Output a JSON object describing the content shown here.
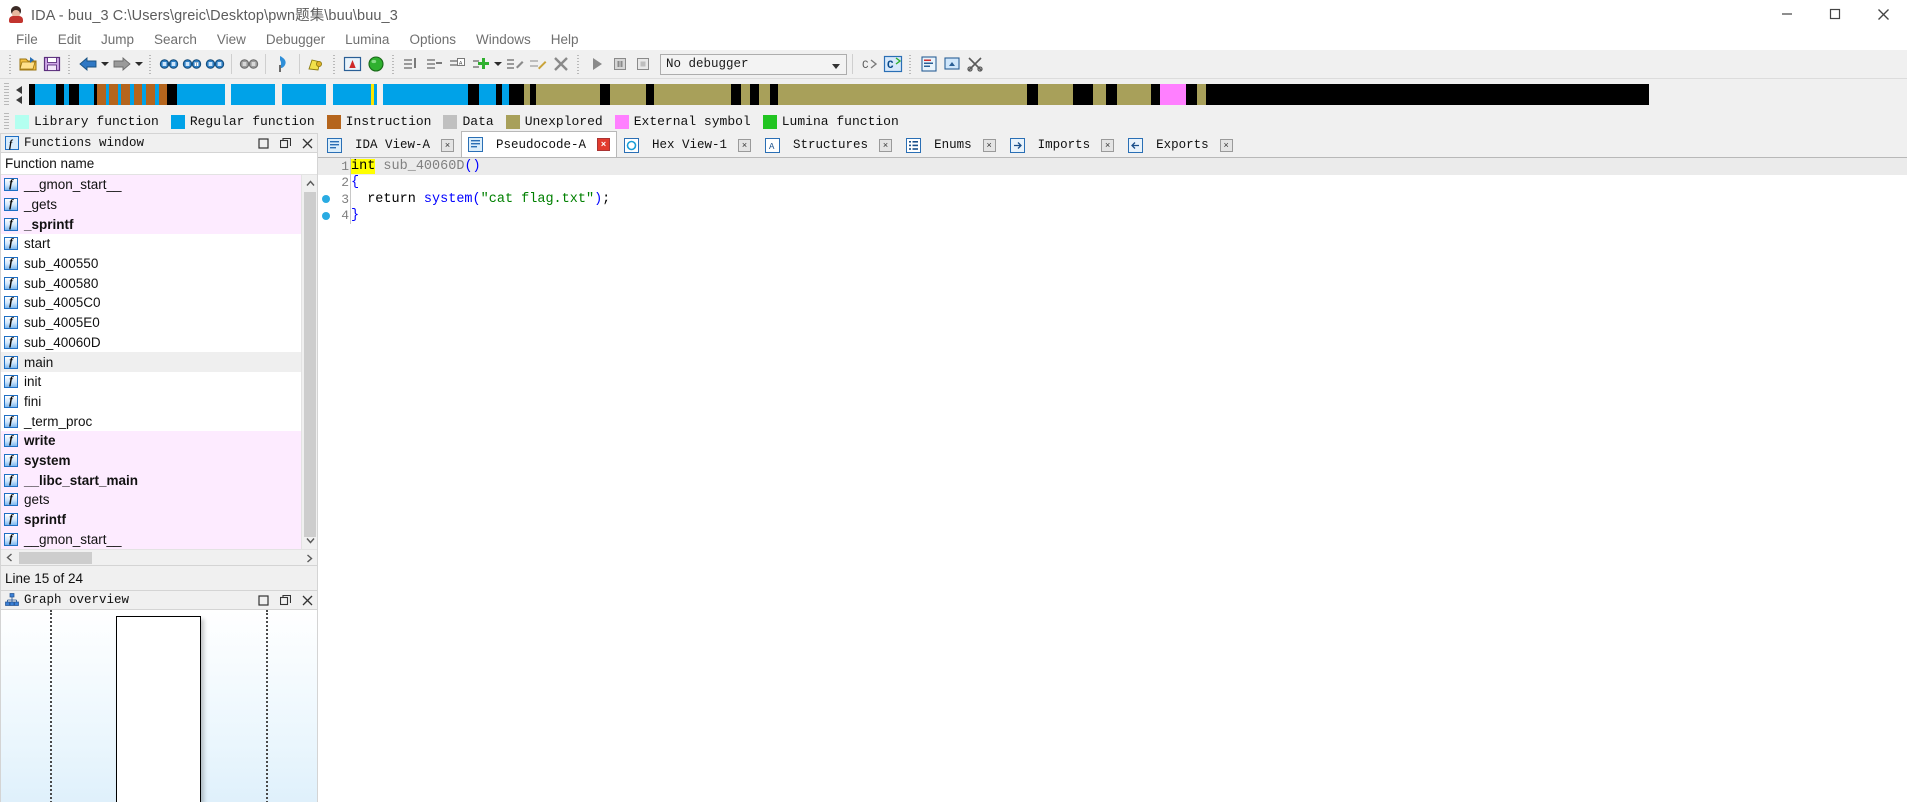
{
  "window": {
    "title": "IDA - buu_3 C:\\Users\\greic\\Desktop\\pwn题集\\buu\\buu_3",
    "icon": "ida-app-icon",
    "buttons": {
      "minimize": "minimize-icon",
      "maximize": "maximize-icon",
      "close": "close-icon"
    }
  },
  "menu": {
    "items": [
      {
        "label": "File"
      },
      {
        "label": "Edit"
      },
      {
        "label": "Jump"
      },
      {
        "label": "Search"
      },
      {
        "label": "View"
      },
      {
        "label": "Debugger"
      },
      {
        "label": "Lumina"
      },
      {
        "label": "Options"
      },
      {
        "label": "Windows"
      },
      {
        "label": "Help"
      }
    ]
  },
  "toolbar": {
    "debugger_select": {
      "value": "No debugger",
      "placeholder": "No debugger"
    },
    "buttons": [
      {
        "name": "open-file-icon"
      },
      {
        "name": "save-file-icon"
      },
      {
        "name": "back-icon"
      },
      {
        "name": "forward-icon"
      },
      {
        "name": "search-binary-icon"
      },
      {
        "name": "search-text-icon"
      },
      {
        "name": "search-next-icon"
      },
      {
        "name": "search-prev-icon"
      },
      {
        "name": "blue-flag-icon"
      },
      {
        "name": "highlight-icon"
      },
      {
        "name": "ida-view-icon"
      },
      {
        "name": "run-to-cursor-icon"
      },
      {
        "name": "add-breakpoint-icon"
      },
      {
        "name": "del-breakpoint-icon"
      },
      {
        "name": "add-code-icon"
      },
      {
        "name": "add-plus-icon"
      },
      {
        "name": "edit-func-icon"
      },
      {
        "name": "undefine-icon"
      },
      {
        "name": "delete-x-icon"
      },
      {
        "name": "run-icon"
      },
      {
        "name": "pause-icon"
      },
      {
        "name": "stop-icon"
      },
      {
        "name": "c-decompile-icon"
      },
      {
        "name": "c-plugin-icon"
      },
      {
        "name": "strings-icon"
      },
      {
        "name": "lumina-push-icon"
      },
      {
        "name": "lumina-cut-icon"
      }
    ]
  },
  "navigator": {
    "marker_position_pct": 18.5,
    "segments": [
      {
        "color": "#bfbfbf",
        "width_pct": 0.0
      },
      {
        "color": "#000000",
        "width_pct": 0.35
      },
      {
        "color": "#00a2e8",
        "width_pct": 1.1
      },
      {
        "color": "#000000",
        "width_pct": 0.45
      },
      {
        "color": "#00a2e8",
        "width_pct": 0.25
      },
      {
        "color": "#000000",
        "width_pct": 0.55
      },
      {
        "color": "#00a2e8",
        "width_pct": 0.8
      },
      {
        "color": "#000000",
        "width_pct": 0.2
      },
      {
        "color": "#b5651d",
        "width_pct": 0.45
      },
      {
        "color": "#00a2e8",
        "width_pct": 0.2
      },
      {
        "color": "#b5651d",
        "width_pct": 0.45
      },
      {
        "color": "#00a2e8",
        "width_pct": 0.2
      },
      {
        "color": "#b5651d",
        "width_pct": 0.5
      },
      {
        "color": "#00a2e8",
        "width_pct": 0.2
      },
      {
        "color": "#b5651d",
        "width_pct": 0.45
      },
      {
        "color": "#00a2e8",
        "width_pct": 0.2
      },
      {
        "color": "#b5651d",
        "width_pct": 0.5
      },
      {
        "color": "#00a2e8",
        "width_pct": 0.2
      },
      {
        "color": "#b5651d",
        "width_pct": 0.45
      },
      {
        "color": "#000000",
        "width_pct": 0.5
      },
      {
        "color": "#00a2e8",
        "width_pct": 2.6
      },
      {
        "color": "#f0f0f0",
        "width_pct": 0.35
      },
      {
        "color": "#00a2e8",
        "width_pct": 2.4
      },
      {
        "color": "#f0f0f0",
        "width_pct": 0.35
      },
      {
        "color": "#00a2e8",
        "width_pct": 2.4
      },
      {
        "color": "#f0f0f0",
        "width_pct": 0.35
      },
      {
        "color": "#00a2e8",
        "width_pct": 2.4
      },
      {
        "color": "#f0f0f0",
        "width_pct": 0.35
      },
      {
        "color": "#00a2e8",
        "width_pct": 4.6
      },
      {
        "color": "#000000",
        "width_pct": 0.6
      },
      {
        "color": "#00a2e8",
        "width_pct": 0.9
      },
      {
        "color": "#000000",
        "width_pct": 0.35
      },
      {
        "color": "#00a2e8",
        "width_pct": 0.35
      },
      {
        "color": "#000000",
        "width_pct": 0.8
      },
      {
        "color": "#a8a05a",
        "width_pct": 0.35
      },
      {
        "color": "#000000",
        "width_pct": 0.3
      },
      {
        "color": "#a8a05a",
        "width_pct": 3.5
      },
      {
        "color": "#000000",
        "width_pct": 0.5
      },
      {
        "color": "#a8a05a",
        "width_pct": 2.0
      },
      {
        "color": "#000000",
        "width_pct": 0.4
      },
      {
        "color": "#a8a05a",
        "width_pct": 4.2
      },
      {
        "color": "#000000",
        "width_pct": 0.5
      },
      {
        "color": "#a8a05a",
        "width_pct": 0.5
      },
      {
        "color": "#000000",
        "width_pct": 0.5
      },
      {
        "color": "#a8a05a",
        "width_pct": 0.6
      },
      {
        "color": "#000000",
        "width_pct": 0.4
      },
      {
        "color": "#a8a05a",
        "width_pct": 13.5
      },
      {
        "color": "#000000",
        "width_pct": 0.6
      },
      {
        "color": "#a8a05a",
        "width_pct": 1.9
      },
      {
        "color": "#000000",
        "width_pct": 1.1
      },
      {
        "color": "#a8a05a",
        "width_pct": 0.7
      },
      {
        "color": "#000000",
        "width_pct": 0.6
      },
      {
        "color": "#a8a05a",
        "width_pct": 1.8
      },
      {
        "color": "#000000",
        "width_pct": 0.5
      },
      {
        "color": "#ff7fff",
        "width_pct": 1.4
      },
      {
        "color": "#000000",
        "width_pct": 0.6
      },
      {
        "color": "#a8a05a",
        "width_pct": 0.5
      },
      {
        "color": "#000000",
        "width_pct": 24.0
      },
      {
        "color": "#f0f0f0",
        "width_pct": 18.0
      }
    ]
  },
  "legend": {
    "items": [
      {
        "label": "Library function",
        "color": "#b3fff0"
      },
      {
        "label": "Regular function",
        "color": "#00a2e8"
      },
      {
        "label": "Instruction",
        "color": "#b5651d"
      },
      {
        "label": "Data",
        "color": "#c0c0c0"
      },
      {
        "label": "Unexplored",
        "color": "#a8a05a"
      },
      {
        "label": "External symbol",
        "color": "#ff7fff"
      },
      {
        "label": "Lumina function",
        "color": "#22c522"
      }
    ]
  },
  "functions_window": {
    "panel_title": "Functions window",
    "panel_icon": "function-panel-icon",
    "column_header": "Function name",
    "status": "Line 15 of 24",
    "panel_buttons": [
      {
        "name": "maximize-panel-icon"
      },
      {
        "name": "float-panel-icon"
      },
      {
        "name": "close-panel-icon"
      }
    ],
    "rows": [
      {
        "name": "__gmon_start__",
        "kind": "library",
        "bold": false,
        "selected": false
      },
      {
        "name": "_gets",
        "kind": "library",
        "bold": false,
        "selected": false
      },
      {
        "name": "_sprintf",
        "kind": "library",
        "bold": true,
        "selected": false
      },
      {
        "name": "start",
        "kind": "regular",
        "bold": false,
        "selected": false
      },
      {
        "name": "sub_400550",
        "kind": "regular",
        "bold": false,
        "selected": false
      },
      {
        "name": "sub_400580",
        "kind": "regular",
        "bold": false,
        "selected": false
      },
      {
        "name": "sub_4005C0",
        "kind": "regular",
        "bold": false,
        "selected": false
      },
      {
        "name": "sub_4005E0",
        "kind": "regular",
        "bold": false,
        "selected": false
      },
      {
        "name": "sub_40060D",
        "kind": "regular",
        "bold": false,
        "selected": false
      },
      {
        "name": "main",
        "kind": "regular",
        "bold": false,
        "selected": true
      },
      {
        "name": "init",
        "kind": "regular",
        "bold": false,
        "selected": false
      },
      {
        "name": "fini",
        "kind": "regular",
        "bold": false,
        "selected": false
      },
      {
        "name": "_term_proc",
        "kind": "regular",
        "bold": false,
        "selected": false
      },
      {
        "name": "write",
        "kind": "library",
        "bold": true,
        "selected": false
      },
      {
        "name": "system",
        "kind": "library",
        "bold": true,
        "selected": false
      },
      {
        "name": "__libc_start_main",
        "kind": "library",
        "bold": true,
        "selected": false
      },
      {
        "name": "gets",
        "kind": "library",
        "bold": false,
        "selected": false
      },
      {
        "name": "sprintf",
        "kind": "library",
        "bold": true,
        "selected": false
      },
      {
        "name": "__gmon_start__",
        "kind": "library",
        "bold": false,
        "selected": false
      }
    ]
  },
  "graph_overview": {
    "panel_title": "Graph overview",
    "panel_icon": "graph-overview-icon",
    "panel_buttons": [
      {
        "name": "maximize-panel-icon"
      },
      {
        "name": "float-panel-icon"
      },
      {
        "name": "close-panel-icon"
      }
    ]
  },
  "editor": {
    "tabs": [
      {
        "label": "IDA View-A",
        "icon": "ida-view-tab-icon",
        "active": false,
        "closable": true
      },
      {
        "label": "Pseudocode-A",
        "icon": "pseudocode-tab-icon",
        "active": true,
        "closable": true
      },
      {
        "label": "Hex View-1",
        "icon": "hex-view-tab-icon",
        "active": false,
        "closable": true
      },
      {
        "label": "Structures",
        "icon": "structures-tab-icon",
        "active": false,
        "closable": true
      },
      {
        "label": "Enums",
        "icon": "enums-tab-icon",
        "active": false,
        "closable": true
      },
      {
        "label": "Imports",
        "icon": "imports-tab-icon",
        "active": false,
        "closable": true
      },
      {
        "label": "Exports",
        "icon": "exports-tab-icon",
        "active": false,
        "closable": true
      }
    ],
    "pseudocode": {
      "lines": [
        {
          "number": "1",
          "breakpoint_dot": false,
          "cursor_line": true,
          "tokens": [
            {
              "text": "int",
              "style": "kw-hl"
            },
            {
              "text": " ",
              "style": "plain"
            },
            {
              "text": "sub_40060D",
              "style": "fn"
            },
            {
              "text": "()",
              "style": "punct"
            }
          ]
        },
        {
          "number": "2",
          "breakpoint_dot": false,
          "cursor_line": false,
          "tokens": [
            {
              "text": "{",
              "style": "punct"
            }
          ]
        },
        {
          "number": "3",
          "breakpoint_dot": true,
          "cursor_line": false,
          "tokens": [
            {
              "text": "  ",
              "style": "plain"
            },
            {
              "text": "return",
              "style": "plain"
            },
            {
              "text": " ",
              "style": "plain"
            },
            {
              "text": "system",
              "style": "call"
            },
            {
              "text": "(",
              "style": "punct"
            },
            {
              "text": "\"cat flag.txt\"",
              "style": "str"
            },
            {
              "text": ")",
              "style": "punct"
            },
            {
              "text": ";",
              "style": "plain"
            }
          ]
        },
        {
          "number": "4",
          "breakpoint_dot": true,
          "cursor_line": false,
          "tokens": [
            {
              "text": "}",
              "style": "punct"
            }
          ]
        }
      ]
    }
  },
  "colors": {
    "library_function_bg": "#fdebff",
    "selected_row_bg": "#efefef",
    "cursor_line_bg": "#ebebeb",
    "highlight_yellow": "#ffff00",
    "accent_blue": "#00a2e8",
    "string_green": "#008000",
    "keyword_blue": "#0000ff"
  }
}
